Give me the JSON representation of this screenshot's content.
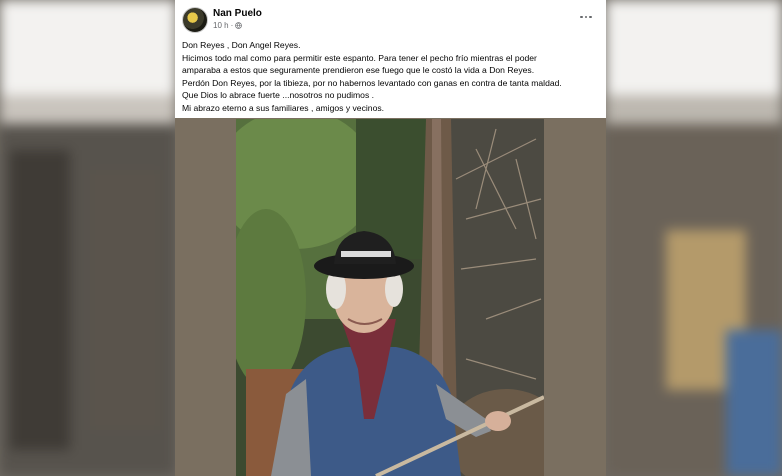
{
  "post": {
    "author": "Nan Puelo",
    "time": "10 h",
    "privacy_icon": "globe-icon",
    "more_icon": "more-options-icon",
    "lines": [
      "Don Reyes , Don Angel Reyes.",
      "Hicimos todo mal como para permitir este espanto. Para tener el pecho frío mientras el poder",
      "amparaba a estos que seguramente prendieron ese fuego que le costó la vida a Don Reyes.",
      "Perdón Don Reyes, por la tibieza, por no habernos levantado con ganas en contra de tanta maldad.",
      "Que Dios lo abrace fuerte ...nosotros no pudimos .",
      "Mi abrazo eterno a sus familiares , amigos y vecinos."
    ]
  },
  "colors": {
    "card_bg": "#ffffff",
    "text": "#050505",
    "secondary_text": "#65676b"
  }
}
